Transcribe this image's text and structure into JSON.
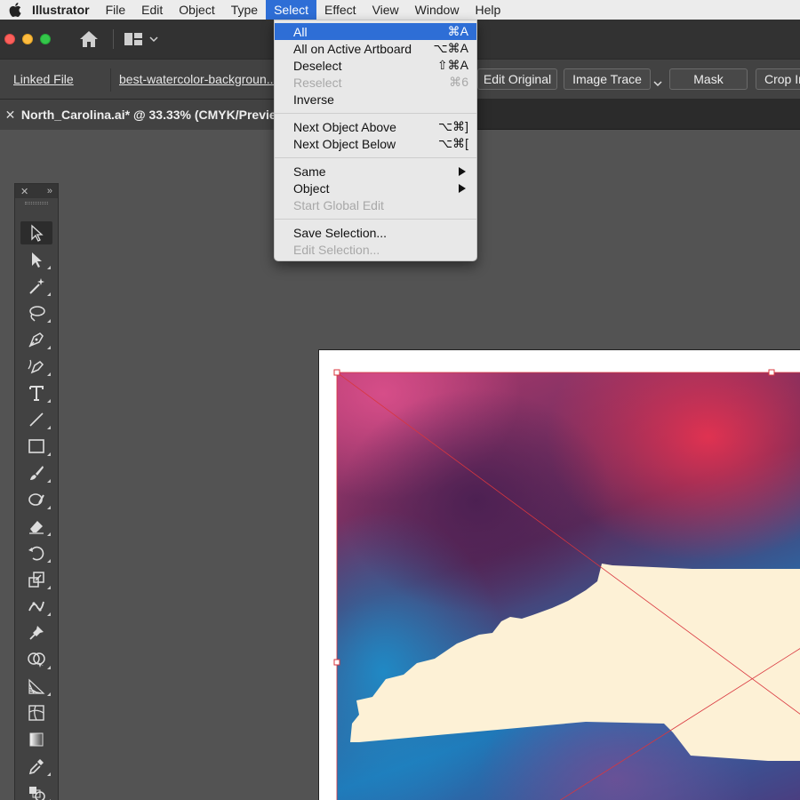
{
  "menubar": {
    "app_name": "Illustrator",
    "items": [
      {
        "label": "File"
      },
      {
        "label": "Edit"
      },
      {
        "label": "Object"
      },
      {
        "label": "Type"
      },
      {
        "label": "Select"
      },
      {
        "label": "Effect"
      },
      {
        "label": "View"
      },
      {
        "label": "Window"
      },
      {
        "label": "Help"
      }
    ],
    "active_menu": "Select"
  },
  "control_bar": {
    "linked_file_label": "Linked File",
    "file_name": "best-watercolor-backgroun...",
    "buttons": [
      {
        "label": "Edit Original"
      },
      {
        "label": "Image Trace"
      },
      {
        "label": "Mask"
      },
      {
        "label": "Crop Ir"
      }
    ]
  },
  "document": {
    "tab_title": "North_Carolina.ai* @ 33.33% (CMYK/Preview)"
  },
  "select_menu": {
    "groups": [
      [
        {
          "label": "All",
          "shortcut": "⌘A",
          "highlighted": true,
          "enabled": true
        },
        {
          "label": "All on Active Artboard",
          "shortcut": "⌥⌘A",
          "enabled": true
        },
        {
          "label": "Deselect",
          "shortcut": "⇧⌘A",
          "enabled": true
        },
        {
          "label": "Reselect",
          "shortcut": "⌘6",
          "enabled": false
        },
        {
          "label": "Inverse",
          "shortcut": "",
          "enabled": true
        }
      ],
      [
        {
          "label": "Next Object Above",
          "shortcut": "⌥⌘]",
          "enabled": true
        },
        {
          "label": "Next Object Below",
          "shortcut": "⌥⌘[",
          "enabled": true
        }
      ],
      [
        {
          "label": "Same",
          "submenu": true,
          "enabled": true
        },
        {
          "label": "Object",
          "submenu": true,
          "enabled": true
        },
        {
          "label": "Start Global Edit",
          "shortcut": "",
          "enabled": false
        }
      ],
      [
        {
          "label": "Save Selection...",
          "shortcut": "",
          "enabled": true
        },
        {
          "label": "Edit Selection...",
          "shortcut": "",
          "enabled": false
        }
      ]
    ]
  },
  "colors": {
    "menu_highlight": "#2e6ed6",
    "canvas_bg": "#535353",
    "panel_bg": "#424242",
    "shape_fill": "#fdf1d6",
    "selection_line": "#d9363e"
  },
  "tools": [
    {
      "name": "selection-tool-icon",
      "selected": true
    },
    {
      "name": "direct-selection-tool-icon"
    },
    {
      "name": "magic-wand-tool-icon"
    },
    {
      "name": "lasso-tool-icon"
    },
    {
      "name": "pen-tool-icon"
    },
    {
      "name": "curvature-tool-icon"
    },
    {
      "name": "type-tool-icon"
    },
    {
      "name": "line-segment-tool-icon"
    },
    {
      "name": "rectangle-tool-icon"
    },
    {
      "name": "paintbrush-tool-icon"
    },
    {
      "name": "shaper-tool-icon"
    },
    {
      "name": "eraser-tool-icon"
    },
    {
      "name": "rotate-tool-icon"
    },
    {
      "name": "scale-tool-icon"
    },
    {
      "name": "puppet-warp-tool-icon"
    },
    {
      "name": "pin-tool-icon"
    },
    {
      "name": "shape-builder-tool-icon"
    },
    {
      "name": "perspective-grid-tool-icon"
    },
    {
      "name": "mesh-tool-icon"
    },
    {
      "name": "gradient-tool-icon"
    },
    {
      "name": "eyedropper-tool-icon"
    },
    {
      "name": "blend-tool-icon"
    }
  ]
}
